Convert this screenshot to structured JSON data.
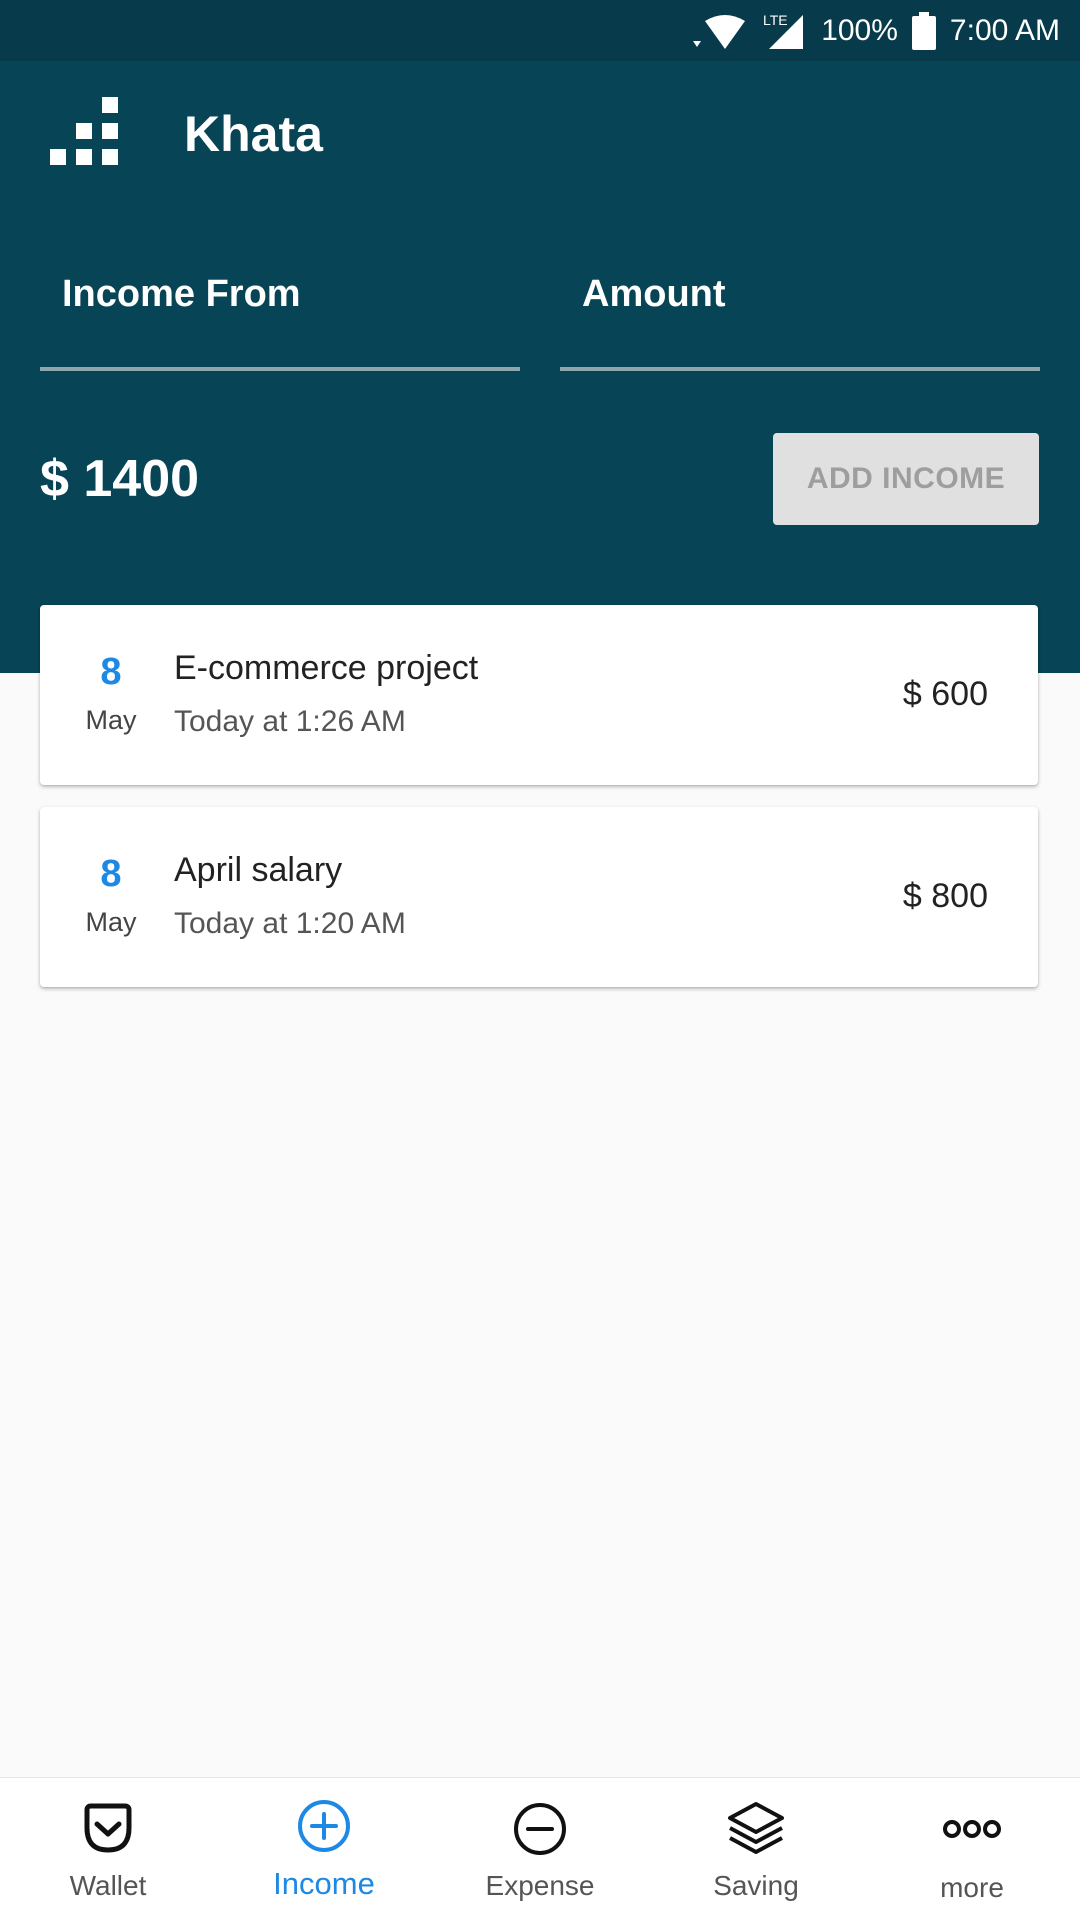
{
  "status_bar": {
    "network": "LTE",
    "battery": "100%",
    "time": "7:00 AM"
  },
  "app": {
    "title": "Khata",
    "logo_icon": "bar-chart-icon"
  },
  "form": {
    "income_from_label": "Income From",
    "amount_label": "Amount",
    "total": "$ 1400",
    "add_button_label": "ADD INCOME"
  },
  "entries": [
    {
      "day": "8",
      "month": "May",
      "title": "E-commerce project",
      "time": "Today at 1:26 AM",
      "amount": "$ 600"
    },
    {
      "day": "8",
      "month": "May",
      "title": "April salary",
      "time": "Today at 1:20 AM",
      "amount": "$ 800"
    }
  ],
  "nav": {
    "items": [
      {
        "label": "Wallet",
        "icon": "wallet-icon"
      },
      {
        "label": "Income",
        "icon": "plus-circle-icon",
        "active": true
      },
      {
        "label": "Expense",
        "icon": "minus-circle-icon"
      },
      {
        "label": "Saving",
        "icon": "layers-icon"
      },
      {
        "label": "more",
        "icon": "more-dots-icon"
      }
    ]
  },
  "colors": {
    "header": "#074455",
    "status_bar": "#073a4a",
    "accent": "#1e88e5",
    "button_disabled": "#e0e0e0"
  }
}
